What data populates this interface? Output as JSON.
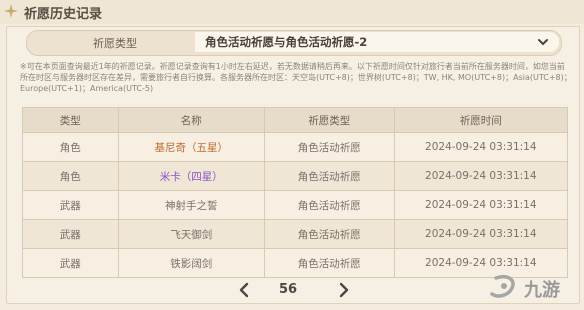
{
  "title": "祈愿历史记录",
  "filter": {
    "label": "祈愿类型",
    "selected": "角色活动祈愿与角色活动祈愿-2"
  },
  "notice": "※可在本页面查询最近1年的祈愿记录。祈愿记录查询有1小时左右延迟，若无数据请稍后再来。以下祈愿时间仅针对旅行者当前所在服务器时间，如您当前所在时区与服务器时区存在差异，需要旅行者自行换算。各服务器所在时区：天空岛(UTC+8)；世界树(UTC+8)；TW, HK, MO(UTC+8)；Asia(UTC+8)；Europe(UTC+1)；America(UTC-5)",
  "table": {
    "headers": [
      "类型",
      "名称",
      "祈愿类型",
      "祈愿时间"
    ],
    "rows": [
      {
        "type": "角色",
        "name": "基尼奇（五星）",
        "wish_type": "角色活动祈愿",
        "time": "2024-09-24 03:31:14",
        "name_color": "#c06a2e"
      },
      {
        "type": "角色",
        "name": "米卡（四星）",
        "wish_type": "角色活动祈愿",
        "time": "2024-09-24 03:31:14",
        "name_color": "#8b52c8"
      },
      {
        "type": "武器",
        "name": "神射手之誓",
        "wish_type": "角色活动祈愿",
        "time": "2024-09-24 03:31:14",
        "name_color": "#7a7169"
      },
      {
        "type": "武器",
        "name": "飞天御剑",
        "wish_type": "角色活动祈愿",
        "time": "2024-09-24 03:31:14",
        "name_color": "#7a7169"
      },
      {
        "type": "武器",
        "name": "铁影阔剑",
        "wish_type": "角色活动祈愿",
        "time": "2024-09-24 03:31:14",
        "name_color": "#7a7169"
      }
    ]
  },
  "pagination": {
    "page": "56"
  },
  "watermark": "九游"
}
